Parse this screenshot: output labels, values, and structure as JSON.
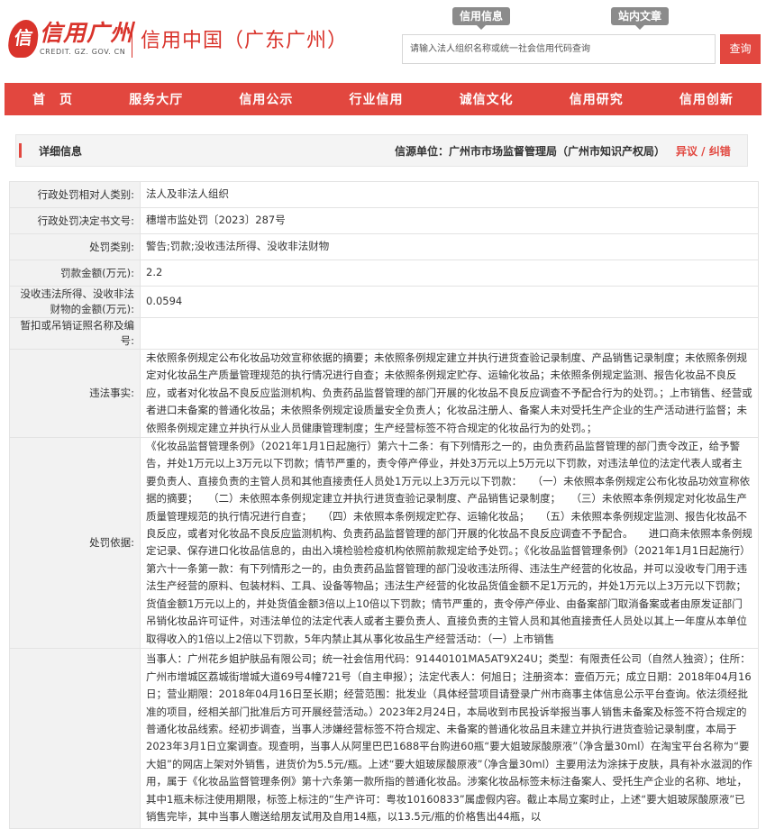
{
  "header": {
    "logo_mark": "信",
    "logo_text": "信用广州",
    "logo_domain": "CREDIT. GZ. GOV. CN",
    "site_title": "信用中国（广东广州）",
    "tag_credit_info": "信用信息",
    "tag_site_search": "站内文章",
    "search_placeholder": "请输入法人组织名称或统一社会信用代码查询",
    "search_button": "查询"
  },
  "nav": [
    "首　页",
    "服务大厅",
    "信用公示",
    "行业信用",
    "诚信文化",
    "信用研究",
    "信用创新"
  ],
  "panel": {
    "title": "详细信息",
    "source": "信源单位：广州市市场监督管理局（广州市知识产权局）",
    "objection": "异议 / 纠错"
  },
  "rows": [
    {
      "label": "行政处罚相对人类别:",
      "value": "法人及非法人组织"
    },
    {
      "label": "行政处罚决定书文号:",
      "value": "穗增市监处罚〔2023〕287号"
    },
    {
      "label": "处罚类别:",
      "value": "警告;罚款;没收违法所得、没收非法财物"
    },
    {
      "label": "罚款金额(万元):",
      "value": "2.2"
    },
    {
      "label": "没收违法所得、没收非法财物的金额(万元):",
      "value": "0.0594"
    },
    {
      "label": "暂扣或吊销证照名称及编号:",
      "value": ""
    },
    {
      "label": "违法事实:",
      "value": "未依照条例规定公布化妆品功效宣称依据的摘要；未依照条例规定建立并执行进货查验记录制度、产品销售记录制度；未依照条例规定对化妆品生产质量管理规范的执行情况进行自查；未依照条例规定贮存、运输化妆品；未依照条例规定监测、报告化妆品不良反应，或者对化妆品不良反应监测机构、负责药品监督管理的部门开展的化妆品不良反应调查不予配合行为的处罚。；上市销售、经营或者进口未备案的普通化妆品；未依照条例规定设质量安全负责人；化妆品注册人、备案人未对受托生产企业的生产活动进行监督；未依照条例规定建立并执行从业人员健康管理制度；生产经营标签不符合规定的化妆品行为的处罚。；"
    },
    {
      "label": "处罚依据:",
      "value": "《化妆品监督管理条例》（2021年1月1日起施行）第六十二条：有下列情形之一的，由负责药品监督管理的部门责令改正，给予警告，并处1万元以上3万元以下罚款；情节严重的，责令停产停业，并处3万元以上5万元以下罚款，对违法单位的法定代表人或者主要负责人、直接负责的主管人员和其他直接责任人员处1万元以上3万元以下罚款：　　（一）未依照本条例规定公布化妆品功效宣称依据的摘要；　　（二）未依照本条例规定建立并执行进货查验记录制度、产品销售记录制度；　　（三）未依照本条例规定对化妆品生产质量管理规范的执行情况进行自查；　　（四）未依照本条例规定贮存、运输化妆品；　　（五）未依照本条例规定监测、报告化妆品不良反应，或者对化妆品不良反应监测机构、负责药品监督管理的部门开展的化妆品不良反应调查不予配合。　　进口商未依照本条例规定记录、保存进口化妆品信息的，由出入境检验检疫机构依照前款规定给予处罚。；《化妆品监督管理条例》（2021年1月1日起施行）第六十一条第一款：有下列情形之一的，由负责药品监督管理的部门没收违法所得、违法生产经营的化妆品，并可以没收专门用于违法生产经营的原料、包装材料、工具、设备等物品；违法生产经营的化妆品货值金额不足1万元的，并处1万元以上3万元以下罚款；货值金额1万元以上的，并处货值金额3倍以上10倍以下罚款；情节严重的，责令停产停业、由备案部门取消备案或者由原发证部门吊销化妆品许可证件，对违法单位的法定代表人或者主要负责人、直接负责的主管人员和其他直接责任人员处以其上一年度从本单位取得收入的1倍以上2倍以下罚款，5年内禁止其从事化妆品生产经营活动：（一）上市销售"
    },
    {
      "label": "",
      "value": "当事人：广州花乡姐护肤品有限公司；统一社会信用代码：91440101MA5AT9X24U；类型：有限责任公司（自然人独资）；住所：广州市增城区荔城街增城大道69号4幢721号（自主申报）；法定代表人：何旭日；注册资本：壹佰万元；成立日期：2018年04月16日；营业期限：2018年04月16日至长期；经营范围：批发业（具体经营项目请登录广州市商事主体信息公示平台查询。依法须经批准的项目，经相关部门批准后方可开展经营活动。）2023年2月24日，本局收到市民投诉举报当事人销售未备案及标签不符合规定的普通化妆品线索。经初步调查，当事人涉嫌经营标签不符合规定、未备案的普通化妆品且未建立并执行进货查验记录制度，本局于2023年3月1日立案调查。现查明，当事人从阿里巴巴1688平台购进60瓶“要大姐玻尿酸原液”（净含量30ml）在淘宝平台名称为“要大姐”的网店上架对外销售，进货价为5.5元/瓶。上述“要大姐玻尿酸原液”（净含量30ml）主要用法为涂抹于皮肤，具有补水滋润的作用，属于《化妆品监督管理条例》第十六条第一款所指的普通化妆品。涉案化妆品标签未标注备案人、受托生产企业的名称、地址，其中1瓶未标注使用期限，标签上标注的“生产许可：粤妆10160833”属虚假内容。截止本局立案时止，上述“要大姐玻尿酸原液”已销售完毕，其中当事人赠送给朋友试用及自用14瓶，以13.5元/瓶的价格售出44瓶，以"
    }
  ]
}
